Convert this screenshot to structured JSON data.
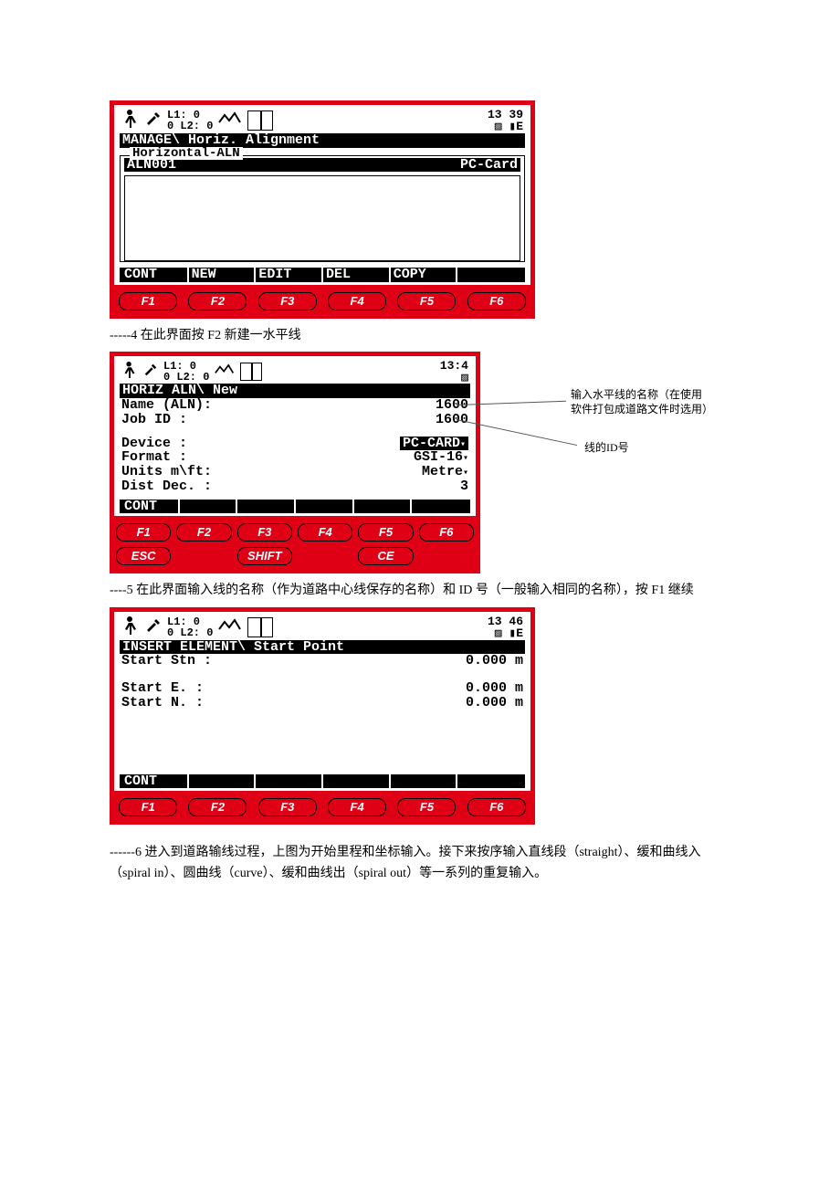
{
  "device1": {
    "header": {
      "l1": "L1: 0",
      "l2": "0 L2: 0",
      "time": "13 39",
      "batt": "▨ ▮E"
    },
    "title": "MANAGE\\ Horiz. Alignment",
    "panel_label": "Horizontal-ALN",
    "row": {
      "name": "ALN001",
      "loc": "PC-Card"
    },
    "soft": [
      "CONT",
      "NEW",
      "EDIT",
      "DEL",
      "COPY",
      ""
    ],
    "fkeys": [
      "F1",
      "F2",
      "F3",
      "F4",
      "F5",
      "F6"
    ]
  },
  "caption1": "-----4  在此界面按 F2 新建一水平线",
  "device2": {
    "header": {
      "l1": "L1: 0",
      "l2": "0 L2: 0",
      "time": "13:4",
      "batt": "▨"
    },
    "title": "HORIZ ALN\\ New",
    "fields": {
      "name_l": "Name (ALN):",
      "name_v": "1600",
      "job_l": "Job ID    :",
      "job_v": "1600",
      "dev_l": "Device    :",
      "dev_v": "PC-CARD",
      "fmt_l": "Format    :",
      "fmt_v": "GSI-16",
      "unit_l": "Units m\\ft:",
      "unit_v": "Metre",
      "dec_l": "Dist Dec. :",
      "dec_v": "3"
    },
    "soft": [
      "CONT",
      "",
      "",
      "",
      "",
      ""
    ],
    "fkeys": [
      "F1",
      "F2",
      "F3",
      "F4",
      "F5",
      "F6"
    ],
    "bottom": [
      "ESC",
      "",
      "SHIFT",
      "",
      "CE",
      ""
    ]
  },
  "annot2": {
    "a": "输入水平线的名称（在使用软件打包成道路文件时选用）",
    "b": "线的ID号"
  },
  "caption2": "----5  在此界面输入线的名称（作为道路中心线保存的名称）和 ID 号（一般输入相同的名称），按 F1 继续",
  "device3": {
    "header": {
      "l1": "L1: 0",
      "l2": "0 L2: 0",
      "time": "13 46",
      "batt": "▨ ▮E"
    },
    "title": "INSERT ELEMENT\\ Start Point",
    "fields": {
      "stn_l": "Start Stn :",
      "stn_v": "0.000",
      "stn_u": "m",
      "e_l": "Start E.  :",
      "e_v": "0.000",
      "e_u": "m",
      "n_l": "Start N.  :",
      "n_v": "0.000",
      "n_u": "m"
    },
    "soft": [
      "CONT",
      "",
      "",
      "",
      "",
      ""
    ],
    "fkeys": [
      "F1",
      "F2",
      "F3",
      "F4",
      "F5",
      "F6"
    ]
  },
  "caption3": "------6  进入到道路输线过程，上图为开始里程和坐标输入。接下来按序输入直线段（straight）、缓和曲线入（spiral in）、圆曲线（curve）、缓和曲线出（spiral out）等一系列的重复输入。"
}
